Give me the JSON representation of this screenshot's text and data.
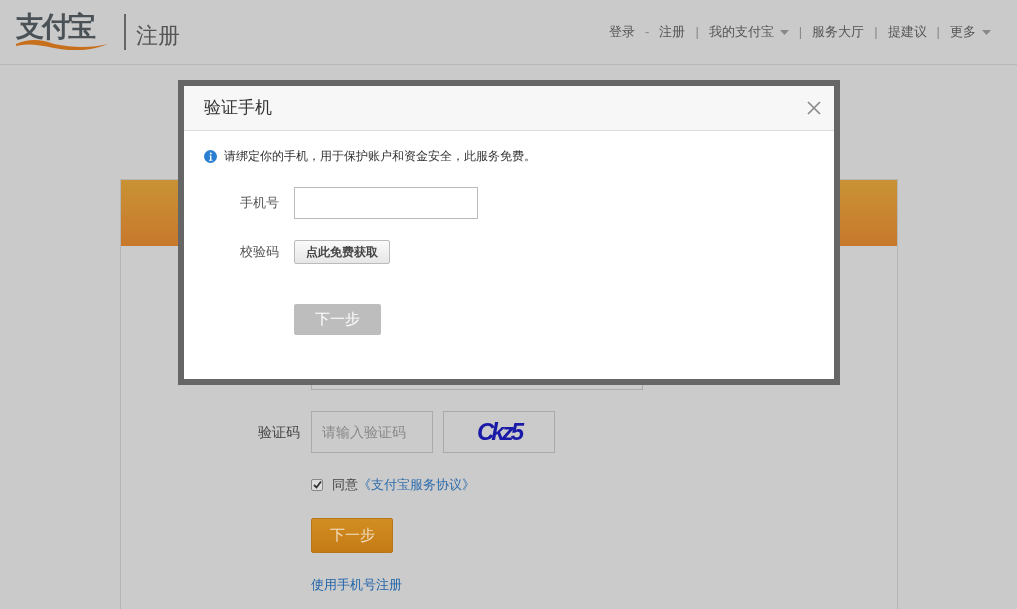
{
  "header": {
    "logo": "支付宝",
    "title": "注册",
    "nav": [
      {
        "label": "登录",
        "kind": "link",
        "separator": "-"
      },
      {
        "label": "注册",
        "kind": "link",
        "separator": "|"
      },
      {
        "label": "我的支付宝",
        "kind": "dropdown",
        "separator": "|"
      },
      {
        "label": "服务大厅",
        "kind": "link",
        "separator": "|"
      },
      {
        "label": "提建议",
        "kind": "link",
        "separator": "|"
      },
      {
        "label": "更多",
        "kind": "dropdown"
      }
    ]
  },
  "form": {
    "captcha_label": "验证码",
    "captcha_placeholder": "请输入验证码",
    "captcha": "Ckz5",
    "agree_checked": true,
    "agree_text": "同意",
    "agreement_link": "《支付宝服务协议》",
    "next_button": "下一步",
    "phone_link": "使用手机号注册"
  },
  "dialog": {
    "title": "验证手机",
    "info": "请绑定你的手机，用于保护账户和资金安全，此服务免费。",
    "phone_label": "手机号",
    "code_label": "校验码",
    "get_code_button": "点此免费获取",
    "next_button": {
      "label": "下一步",
      "disabled": true
    }
  }
}
